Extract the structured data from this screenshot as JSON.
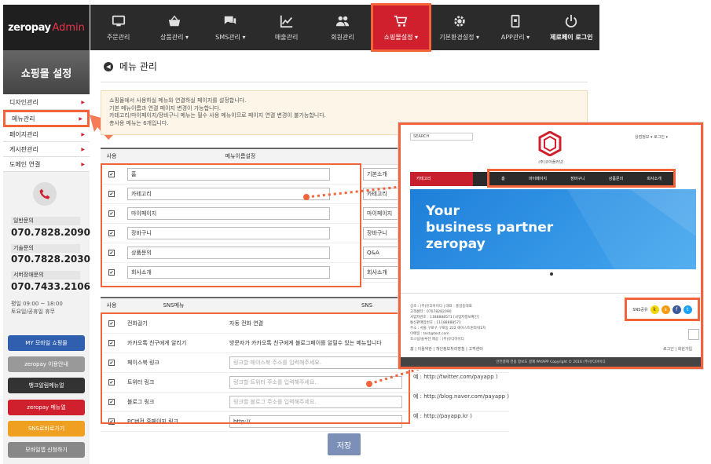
{
  "logo": {
    "brand": "zeropay",
    "suffix": "Admin"
  },
  "nav": {
    "items": [
      {
        "label": "주문관리",
        "icon": "monitor-icon"
      },
      {
        "label": "상품관리 ▾",
        "icon": "basket-icon"
      },
      {
        "label": "SMS관리 ▾",
        "icon": "chat-icon"
      },
      {
        "label": "매출관리",
        "icon": "chart-icon"
      },
      {
        "label": "회원관리",
        "icon": "users-icon"
      },
      {
        "label": "쇼핑몰설정 ▾",
        "icon": "cart-icon"
      },
      {
        "label": "기본환경설정 ▾",
        "icon": "gear-icon"
      },
      {
        "label": "APP관리 ▾",
        "icon": "mobile-icon"
      },
      {
        "label": "제로페이 로그인",
        "icon": "power-icon"
      }
    ]
  },
  "sidebar": {
    "title": "쇼핑몰 설정",
    "items": [
      "디자인관리",
      "메뉴관리",
      "페이지관리",
      "게시판관리",
      "도메인 연결"
    ],
    "contacts": [
      {
        "label": "일반문의",
        "number": "070.7828.2090"
      },
      {
        "label": "기술문의",
        "number": "070.7828.2030"
      },
      {
        "label": "서버장애문의",
        "number": "070.7433.2106"
      }
    ],
    "hours1": "평일 09:00 ~ 18:00",
    "hours2": "토요일/공휴일 휴무",
    "buttons": [
      {
        "label": "MY 모바일 쇼핑몰",
        "color": "#2f5fae"
      },
      {
        "label": "zeropay 이용안내",
        "color": "#999999"
      },
      {
        "label": "뱅크알림메뉴얼",
        "color": "#333333"
      },
      {
        "label": "zeropay 메뉴얼",
        "color": "#d0202e"
      },
      {
        "label": "SNS로바로가기",
        "color": "#f0a020"
      },
      {
        "label": "모바일앱 신청하기",
        "color": "#888888"
      }
    ]
  },
  "page": {
    "title": "메뉴 관리",
    "notice": [
      "쇼핑몰에서 사용하실 메뉴와 연결하실 페이지를 설정합니다.",
      "기본 메뉴이름과 연결 페이지 변경이 가능합니다.",
      "카테고리/마이페이지/장바구니 메뉴는 필수 사용 메뉴이므로 페이지 연결 변경이 불가능합니다.",
      "총사용 메뉴는 6개입니다."
    ]
  },
  "menu_table": {
    "headers": [
      "사용",
      "메뉴이름설정"
    ],
    "rows": [
      {
        "name": "홈",
        "link": "기본소개"
      },
      {
        "name": "카테고리",
        "link": "카테고리"
      },
      {
        "name": "마이페이지",
        "link": "마이페이지"
      },
      {
        "name": "장바구니",
        "link": "장바구니"
      },
      {
        "name": "상품문의",
        "link": "Q&A"
      },
      {
        "name": "회사소개",
        "link": "회사소개"
      }
    ]
  },
  "sns_table": {
    "headers": [
      "사용",
      "SNS메뉴",
      "SNS"
    ],
    "rows": [
      {
        "name": "전화걸기",
        "value": "자동 전화 연결",
        "ph": false,
        "example": ""
      },
      {
        "name": "카카오톡 친구에게 알리기",
        "value": "방문자가 카카오톡 친구에게 블로그페이를 알릴수 있는 메뉴입니다",
        "ph": false,
        "example": ""
      },
      {
        "name": "페이스북 링크",
        "value": "링크할 페이스북 주소를 입력해주세요.",
        "ph": true,
        "example": ""
      },
      {
        "name": "트위터 링크",
        "value": "링크할 트위터 주소를 입력해주세요.",
        "ph": true,
        "example": "예 : http://twitter.com/payapp )"
      },
      {
        "name": "블로그 링크",
        "value": "링크할 블로그 주소를 입력해주세요.",
        "ph": true,
        "example": "예 : http://blog.naver.com/payapp )"
      },
      {
        "name": "PC버전 홈페이지 링크",
        "value": "http://",
        "ph": false,
        "example": "예 : http://payapp.kr )"
      }
    ]
  },
  "save_label": "저장",
  "preview": {
    "search": "SEARCH",
    "top_links": "상점정보 ▾   로그인 ▾",
    "shop_name": "(주)코어플러넷",
    "category": "카테고리",
    "menu": [
      "홈",
      "마이페이지",
      "장바구니",
      "상품문의",
      "회사소개"
    ],
    "banner": [
      "Your",
      "business partner",
      "zeropay"
    ],
    "sns_label": "SNS공유",
    "footer_info": [
      "상호 : (주)유디아이디 | 대표 : 홍길동대표",
      "고객센터 : 07078282090",
      "사업자번호 : 1188888571 [사업자정보확인]",
      "통신판매업번호 : 11188888571",
      "주소 : 서울 구로구 구로동 222 에이스트윈타워1차",
      "이메일 : test@test.com",
      "호스팅/솔루션 제공 : (주)유디아이디"
    ],
    "footer_links": "홈 | 이용약관 | 개인정보처리방침 | 고객센터",
    "footer_right": "로그인 | 회원가입",
    "footer_bar": "안전결제 전용 정보도 결제 PAYAPP  Copyright © 2016 (주)유디아이디"
  }
}
